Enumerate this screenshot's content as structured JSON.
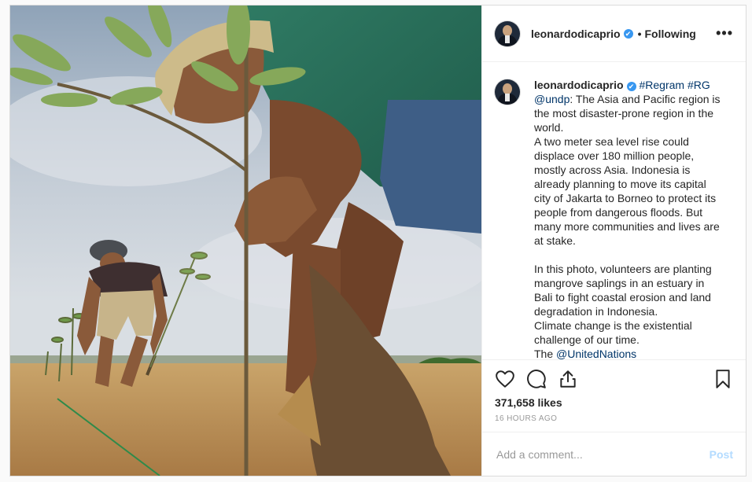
{
  "header": {
    "username": "leonardodicaprio",
    "verified_mark": "✔",
    "separator": "•",
    "follow_state": "Following",
    "more_label": "•••"
  },
  "caption": {
    "username": "leonardodicaprio",
    "tags": "#Regram #RG",
    "mention": "@undp",
    "line1": ": The Asia and Pacific region is the most disaster-prone region in the world.",
    "para2": "A two meter sea level rise could displace over 180 million people, mostly across Asia. Indonesia is already planning to move its capital city of Jakarta to Borneo to protect its people from dangerous floods. But many more communities and lives are at stake.",
    "para3": "In this photo, volunteers are planting mangrove saplings in an estuary in Bali to fight coastal erosion and land degradation in Indonesia.",
    "para4": "Climate change is the existential challenge of our time.",
    "para5_prefix": "The ",
    "para5_mention": "@UnitedNations"
  },
  "actions": {
    "icons": [
      "heart-icon",
      "comment-icon",
      "share-icon",
      "bookmark-icon"
    ],
    "likes": "371,658 likes",
    "timestamp": "16 HOURS AGO"
  },
  "comment": {
    "placeholder": "Add a comment...",
    "post_label": "Post"
  },
  "colors": {
    "accent": "#3897f0",
    "link": "#003569",
    "post_disabled": "#b3dbff"
  }
}
